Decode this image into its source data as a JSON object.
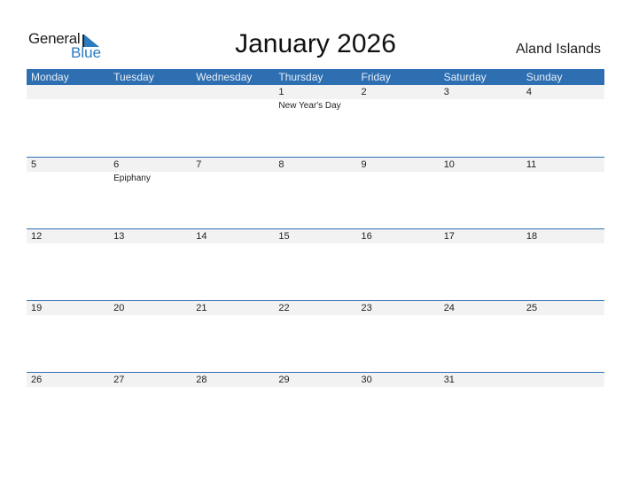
{
  "brand": {
    "word1": "General",
    "word2": "Blue",
    "accent": "#2a7bc0"
  },
  "title": "January 2026",
  "country": "Aland Islands",
  "header_color": "#2e6fb2",
  "weekdays": [
    "Monday",
    "Tuesday",
    "Wednesday",
    "Thursday",
    "Friday",
    "Saturday",
    "Sunday"
  ],
  "weeks": [
    [
      {
        "day": ""
      },
      {
        "day": ""
      },
      {
        "day": ""
      },
      {
        "day": "1",
        "holiday": "New Year's Day"
      },
      {
        "day": "2"
      },
      {
        "day": "3"
      },
      {
        "day": "4"
      }
    ],
    [
      {
        "day": "5"
      },
      {
        "day": "6",
        "holiday": "Epiphany"
      },
      {
        "day": "7"
      },
      {
        "day": "8"
      },
      {
        "day": "9"
      },
      {
        "day": "10"
      },
      {
        "day": "11"
      }
    ],
    [
      {
        "day": "12"
      },
      {
        "day": "13"
      },
      {
        "day": "14"
      },
      {
        "day": "15"
      },
      {
        "day": "16"
      },
      {
        "day": "17"
      },
      {
        "day": "18"
      }
    ],
    [
      {
        "day": "19"
      },
      {
        "day": "20"
      },
      {
        "day": "21"
      },
      {
        "day": "22"
      },
      {
        "day": "23"
      },
      {
        "day": "24"
      },
      {
        "day": "25"
      }
    ],
    [
      {
        "day": "26"
      },
      {
        "day": "27"
      },
      {
        "day": "28"
      },
      {
        "day": "29"
      },
      {
        "day": "30"
      },
      {
        "day": "31"
      },
      {
        "day": ""
      }
    ]
  ]
}
